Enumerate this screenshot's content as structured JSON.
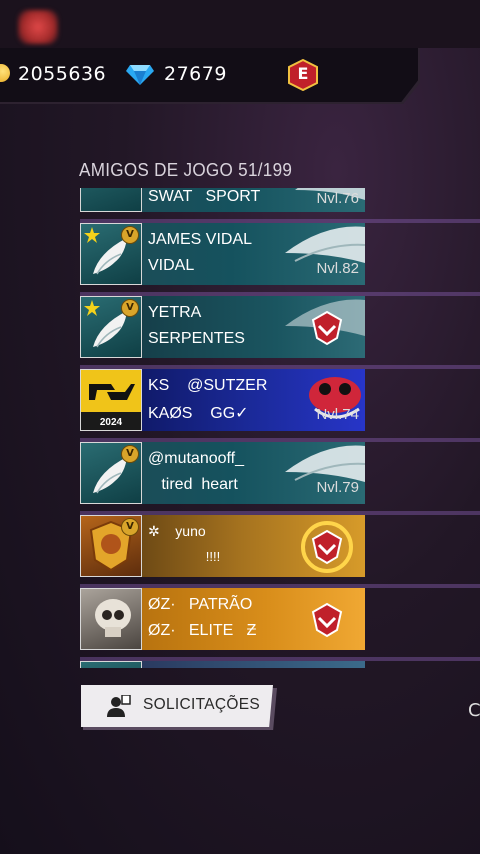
{
  "header": {
    "coins": "2055636",
    "diamonds": "27679",
    "badge_letter": "E"
  },
  "friends": {
    "title": "AMIGOS DE JOGO 51/199",
    "rows": [
      {
        "line1": "SWAT   SPORT",
        "line2": "",
        "level": "Nvl.76",
        "style": "teal",
        "thumb": "wing",
        "emblem": "wing-icon"
      },
      {
        "line1": "JAMES VIDAL",
        "line2": "VIDAL",
        "level": "Nvl.82",
        "style": "teal",
        "thumb": "wing",
        "emblem": "wing-icon"
      },
      {
        "line1": "YETRA",
        "line2": "SERPENTES",
        "level": "",
        "style": "teal2",
        "thumb": "wing",
        "emblem": "guild-emblem-icon"
      },
      {
        "line1": "KS    @SUTZER",
        "line2": "KAØS    GG✓",
        "level": "Nvl.74",
        "style": "blue",
        "thumb": "pain",
        "emblem": "mascot-icon",
        "thumb_text": "2024"
      },
      {
        "line1": "@mutanooff_",
        "line2": "   tired  heart",
        "level": "Nvl.79",
        "style": "teal",
        "thumb": "wing",
        "emblem": "wing-icon"
      },
      {
        "line1": "✲    yuno",
        "line2": "                !!!!",
        "level": "",
        "style": "gold",
        "thumb": "gold",
        "emblem": "guild-emblem-icon"
      },
      {
        "line1": "ØZ·   PATRÃO",
        "line2": "ØZ·   ELITE   Ƶ",
        "level": "",
        "style": "orange",
        "thumb": "skull",
        "emblem": "guild-emblem-icon"
      }
    ]
  },
  "requests_button": {
    "label": "SOLICITAÇÕES"
  },
  "side_cut_text": "C",
  "colors": {
    "accent_gold": "#d9a52a",
    "badge_red": "#c0202a"
  }
}
